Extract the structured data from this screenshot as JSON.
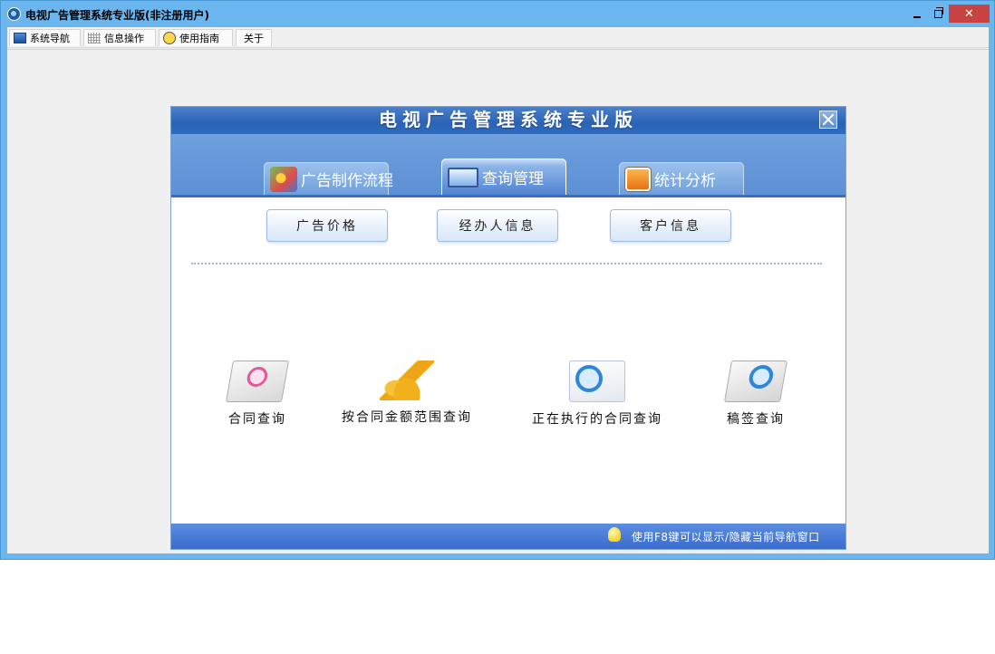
{
  "window": {
    "title": "电视广告管理系统专业版(非注册用户)",
    "close_glyph": "✕"
  },
  "menu": {
    "items": [
      {
        "label": "系统导航",
        "icon": "navigation-icon"
      },
      {
        "label": "信息操作",
        "icon": "grid-icon"
      },
      {
        "label": "使用指南",
        "icon": "guide-icon"
      },
      {
        "label": "关于",
        "icon": ""
      }
    ]
  },
  "nav_panel": {
    "title": "电视广告管理系统专业版",
    "tabs": [
      {
        "label": "广告制作流程",
        "icon": "workflow-icon"
      },
      {
        "label": "查询管理",
        "icon": "monitor-icon",
        "active": true
      },
      {
        "label": "统计分析",
        "icon": "rss-folder-icon"
      }
    ],
    "sub_buttons": [
      "广告价格",
      "经办人信息",
      "客户信息"
    ],
    "features": [
      {
        "label": "合同查询",
        "icon": "contract-search-icon"
      },
      {
        "label": "按合同金额范围查询",
        "icon": "coins-icon"
      },
      {
        "label": "正在执行的合同查询",
        "icon": "book-search-icon"
      },
      {
        "label": "稿签查询",
        "icon": "draft-search-icon"
      }
    ],
    "footer_tip": "使用F8键可以显示/隐藏当前导航窗口"
  },
  "colors": {
    "titlebar": "#6cb6ef",
    "close_button": "#c74342",
    "panel_header": "#2b63b5",
    "panel_footer": "#3a6bcf"
  }
}
